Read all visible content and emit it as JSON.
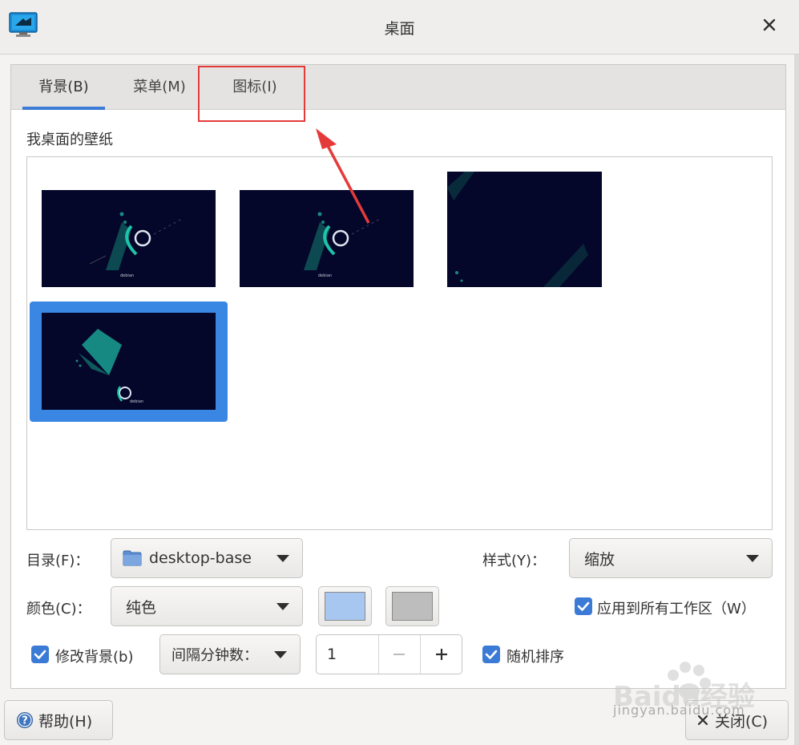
{
  "window": {
    "title": "桌面",
    "app_icon": "desktop-monitor-icon",
    "close_icon": "close-icon"
  },
  "tabs": [
    {
      "label": "背景(B)",
      "active": true
    },
    {
      "label": "菜单(M)",
      "active": false
    },
    {
      "label": "图标(I)",
      "active": false
    }
  ],
  "wallpaper_section": {
    "label": "我桌面的壁纸",
    "thumbnails": [
      {
        "name": "debian-swirl-1",
        "caption": "debian",
        "selected": false
      },
      {
        "name": "debian-swirl-2",
        "caption": "debian",
        "selected": false
      },
      {
        "name": "debian-dark-3",
        "caption": "",
        "selected": false
      },
      {
        "name": "debian-geometric-4",
        "caption": "debian",
        "selected": true
      }
    ]
  },
  "settings": {
    "directory_label": "目录(F)：",
    "directory_value": "desktop-base",
    "style_label": "样式(Y)：",
    "style_value": "缩放",
    "color_label": "颜色(C)：",
    "color_value": "纯色",
    "color1": "#a8c7f0",
    "color2": "#bdbdbd",
    "apply_all_label": "应用到所有工作区（W）",
    "apply_all_checked": true,
    "change_bg_label": "修改背景(b)",
    "change_bg_checked": true,
    "interval_label": "间隔分钟数：",
    "interval_value": "1",
    "random_label": "随机排序",
    "random_checked": true
  },
  "footer": {
    "help_label": "帮助(H)",
    "close_label": "关闭(C)"
  },
  "watermark": {
    "brand": "Baidu经验",
    "url": "jingyan.baidu.com"
  },
  "colors": {
    "accent": "#3b7bd6",
    "annotation": "#e53a3a"
  }
}
